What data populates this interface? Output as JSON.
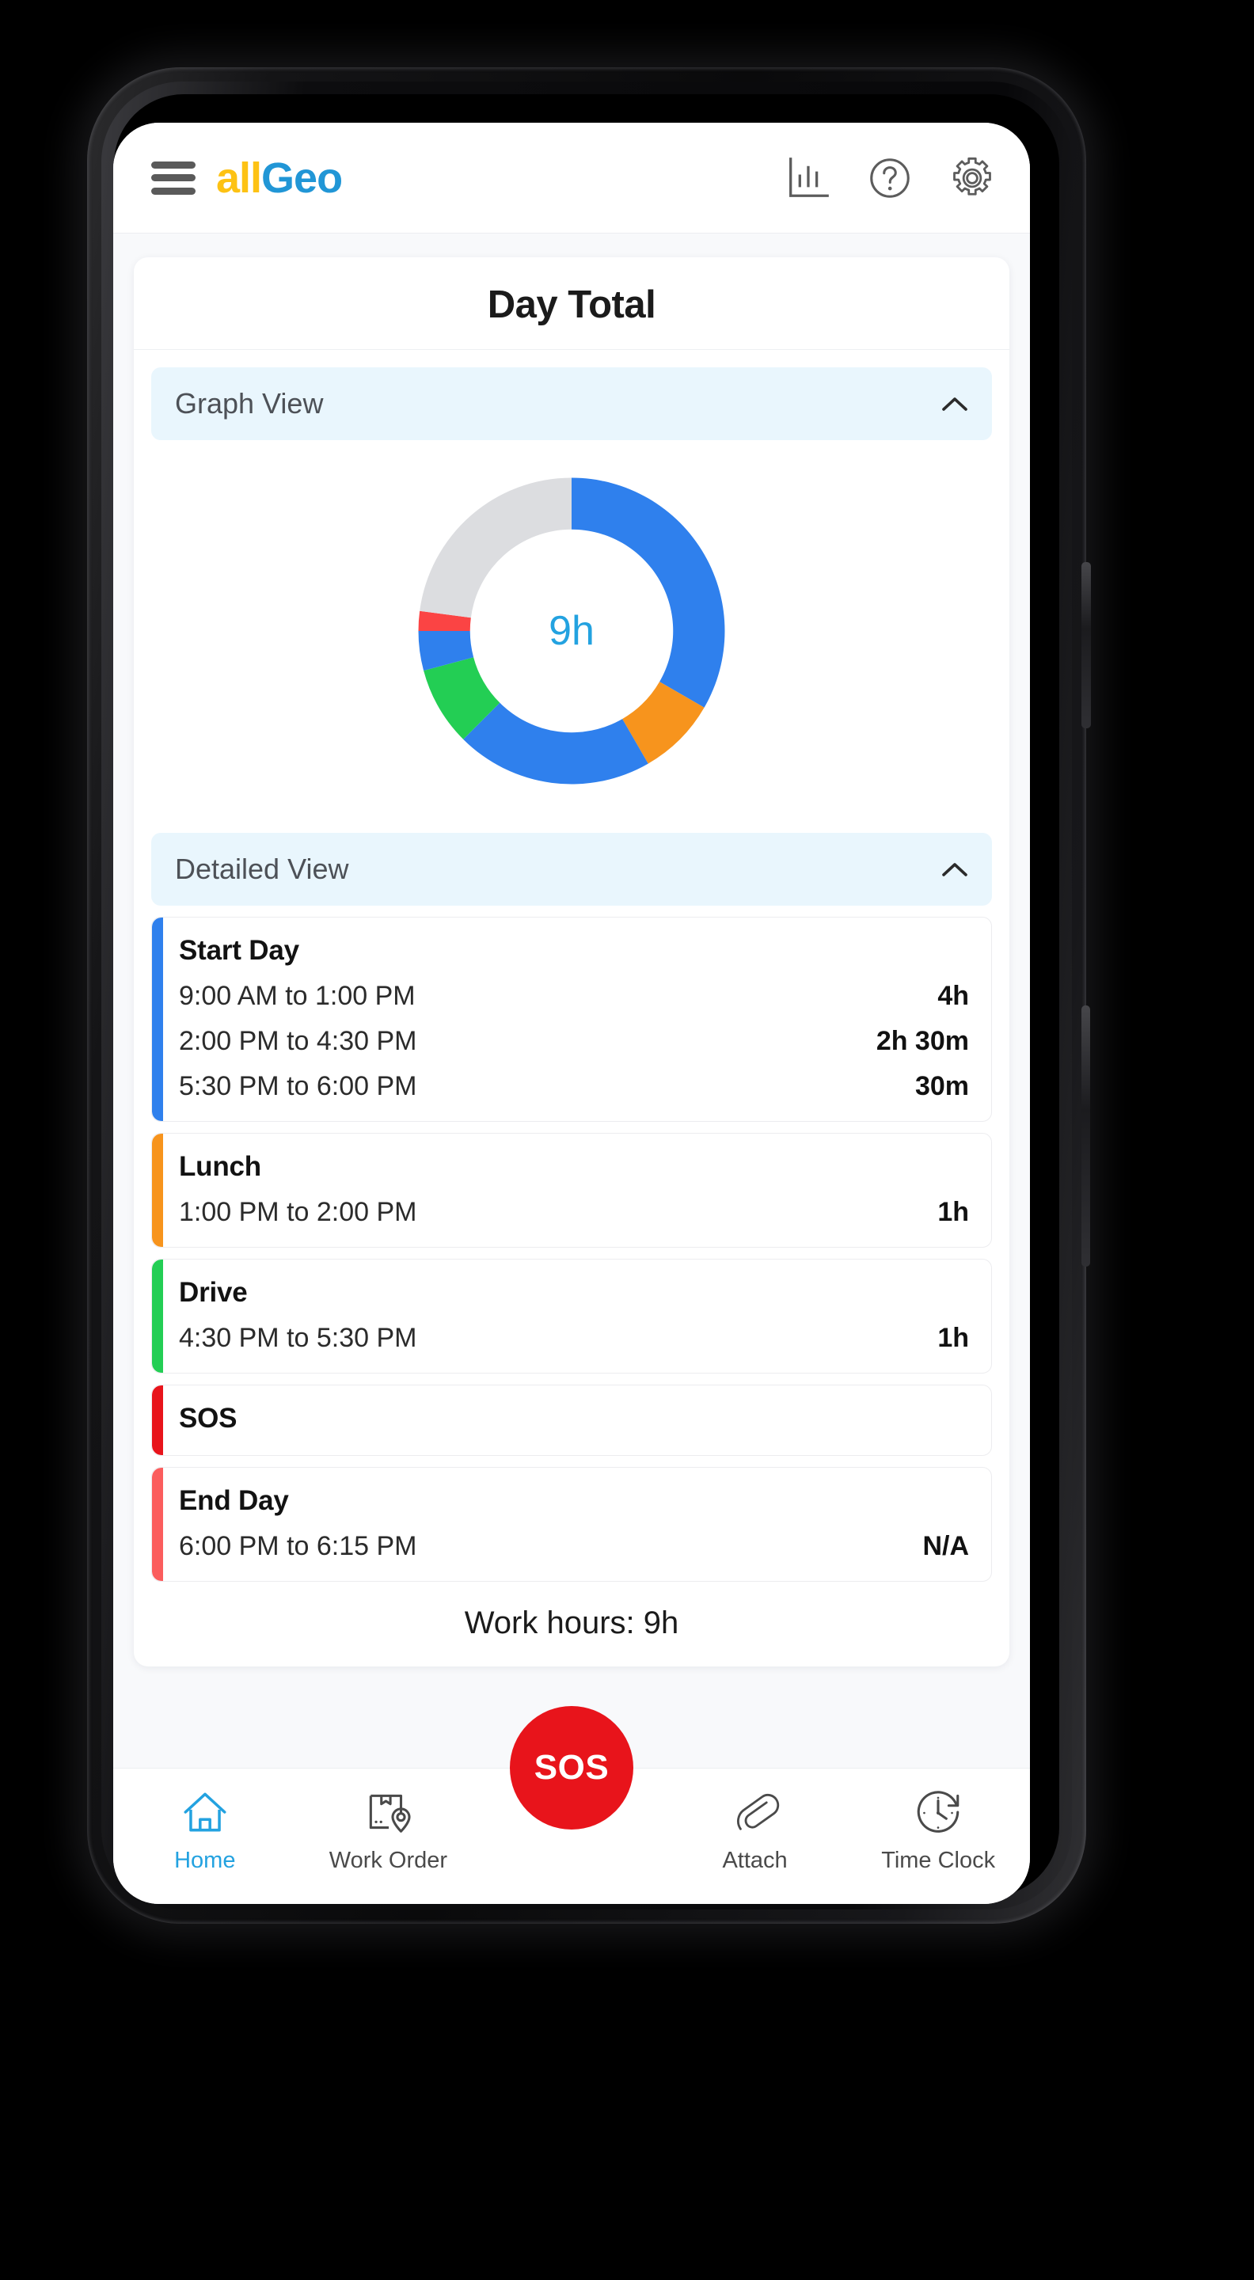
{
  "header": {
    "menu_icon": "hamburger-icon",
    "brand_part1": "all",
    "brand_part2": "Geo",
    "icons": [
      {
        "name": "bar-chart-icon",
        "label": "Reports"
      },
      {
        "name": "help-icon",
        "label": "Help"
      },
      {
        "name": "settings-gear-icon",
        "label": "Settings"
      }
    ]
  },
  "main": {
    "card_title": "Day Total",
    "graph_section": {
      "label": "Graph View",
      "expanded": true,
      "chevron": "chevron-up-icon",
      "center_value": "9h"
    },
    "detail_section": {
      "label": "Detailed View",
      "expanded": true,
      "chevron": "chevron-up-icon"
    },
    "entries": [
      {
        "name": "Start Day",
        "color": "#2f80ed",
        "rows": [
          {
            "range": "9:00 AM to 1:00 PM",
            "duration": "4h"
          },
          {
            "range": "2:00 PM to 4:30 PM",
            "duration": "2h 30m"
          },
          {
            "range": "5:30 PM to 6:00 PM",
            "duration": "30m"
          }
        ]
      },
      {
        "name": "Lunch",
        "color": "#f7941d",
        "rows": [
          {
            "range": "1:00 PM to 2:00 PM",
            "duration": "1h"
          }
        ]
      },
      {
        "name": "Drive",
        "color": "#23ce54",
        "rows": [
          {
            "range": "4:30 PM to 5:30 PM",
            "duration": "1h"
          }
        ]
      },
      {
        "name": "SOS",
        "color": "#e8141b",
        "rows": []
      },
      {
        "name": "End Day",
        "color": "#fb5d5d",
        "rows": [
          {
            "range": "6:00 PM to 6:15 PM",
            "duration": "N/A"
          }
        ]
      }
    ],
    "work_hours_text": "Work hours: 9h"
  },
  "sos_button": {
    "label": "SOS",
    "color": "#e8141b"
  },
  "bottom_nav": {
    "items": [
      {
        "label": "Home",
        "icon": "home-icon",
        "active": true
      },
      {
        "label": "Work Order",
        "icon": "work-order-icon",
        "active": false
      },
      {
        "label": "Attach",
        "icon": "paperclip-icon",
        "active": false
      },
      {
        "label": "Time Clock",
        "icon": "time-clock-icon",
        "active": false
      }
    ],
    "active_color": "#23a2e0"
  },
  "chart_data": {
    "type": "pie",
    "title": "Day Total",
    "center_label": "9h",
    "total_hours_in_ring": 12,
    "ylabel": "",
    "xlabel": "",
    "legend_position": "none",
    "grid": false,
    "start_angle_deg": 0,
    "direction": "clockwise",
    "categories": [
      "Start Day",
      "Lunch",
      "Start Day",
      "Drive",
      "Start Day",
      "End Day",
      "Remaining"
    ],
    "values": [
      4,
      1,
      2.5,
      1,
      0.5,
      0.25,
      2.75
    ],
    "value_units": "hours",
    "colors": [
      "#2f80ed",
      "#f7941d",
      "#2f80ed",
      "#23ce54",
      "#2f80ed",
      "#fb4444",
      "#dcdde0"
    ],
    "series": [
      {
        "name": "Day segments",
        "slices": [
          {
            "label": "Start Day",
            "hours": 4,
            "color": "#2f80ed",
            "range": "9:00 AM to 1:00 PM"
          },
          {
            "label": "Lunch",
            "hours": 1,
            "color": "#f7941d",
            "range": "1:00 PM to 2:00 PM"
          },
          {
            "label": "Start Day",
            "hours": 2.5,
            "color": "#2f80ed",
            "range": "2:00 PM to 4:30 PM"
          },
          {
            "label": "Drive",
            "hours": 1,
            "color": "#23ce54",
            "range": "4:30 PM to 5:30 PM"
          },
          {
            "label": "Start Day",
            "hours": 0.5,
            "color": "#2f80ed",
            "range": "5:30 PM to 6:00 PM"
          },
          {
            "label": "End Day",
            "hours": 0.25,
            "color": "#fb4444",
            "range": "6:00 PM to 6:15 PM"
          },
          {
            "label": "Remaining",
            "hours": 2.75,
            "color": "#dcdde0",
            "range": ""
          }
        ]
      }
    ]
  }
}
